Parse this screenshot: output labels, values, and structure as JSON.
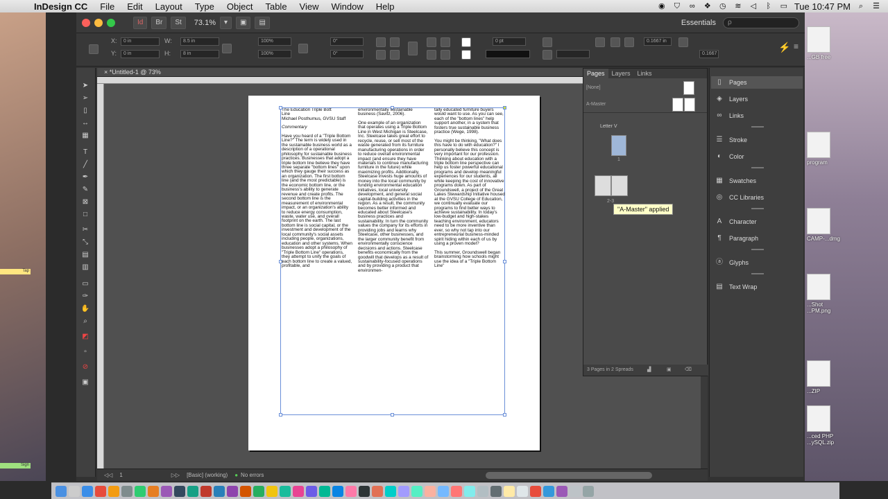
{
  "menubar": {
    "app_name": "InDesign CC",
    "items": [
      "File",
      "Edit",
      "Layout",
      "Type",
      "Object",
      "Table",
      "View",
      "Window",
      "Help"
    ],
    "clock": "Tue 10:47 PM"
  },
  "titlebar": {
    "zoom": "73.1%",
    "workspace": "Essentials",
    "search_placeholder": "ρ"
  },
  "control": {
    "x": "0 in",
    "y": "0 in",
    "w": "8.5 in",
    "h": "8 in",
    "scale_x": "100%",
    "scale_y": "100%",
    "rotate": "0°",
    "shear": "0°",
    "stroke": "0 pt",
    "p1": "0.1667 in",
    "p2": "0.1667"
  },
  "document": {
    "tab": "*Untitled-1 @ 73%",
    "col1": [
      "The Education Triple Bott",
      "Line",
      "Michael Posthumus, GVSU Staff",
      "Commentary",
      "Have you heard of a \"Triple Bottom Line?\" The term is widely used in the sustainable business world as a description of a operational philosophy for sustainable business practices. Businesses that adopt a triple bottom line believe they have three separate \"bottom lines\" upon which they gauge their success as an organization. The first bottom line (and the most predictable) is the economic bottom line, or the business's ability to generate revenue and create profits. The second bottom line is the measurement of environmental impact, or an organization's ability to reduce energy consumption, waste, water use, and overall footprint on the earth. The last bottom line is social capital, or the investment and development of the local community's social assets including people, organizations, education and other systems. When businesses adopt a philosophy of \"Triple Bottom Line\" operations, they attempt to unify the goals of each bottom line to create a valued, profitable, and"
    ],
    "col2": [
      "environmentally sustainable business (Savitz, 2006).",
      "One example of an organization that operates using a Triple Bottom Line in West Michigan is Steelcase, Inc. Steelcase takes great effort to recycle, reuse, or sell most of the waste generated from its furniture manufacturing operations in order to reduce overall environmental impact (and ensure they have materials to continue manufacturing furniture in the future) while maximizing profits. Additionally, Steelcase invests huge amounts of money into the local community by funding environmental education initiatives, local university development, and general social capital-building activities in the region. As a result, the community becomes better informed and educated about Steelcase's business practices and sustainability. In turn the community values the company for its efforts in providing jobs and learns why Steelcase, other businesses, and the larger community benefit from environmentally conscience decisions and actions. Steelcase benefits economically from the goodwill that develops as a result of sustainability-focused operations and by providing a product that environmen-"
    ],
    "col3": [
      "tally educated furniture buyers would want to use. As you can see, each of the \"bottom lines\" help support another, in a system that fosters true sustainable business practice (Wege, 1998).",
      "You might be thinking, \"What does this have to do with education?\" I personally believe this concept is very important for our profession. Thinking about education with a triple bottom line perspective can help us foster powerful educational programs and develop meaningful experiences for our students, all while keeping the cost of innovative programs down. As part of Groundswell, a project of the Great Lakes Stewardship Initiative housed at the GVSU College of Education, we continually evaluate our programs to find better ways to achieve sustainability. In today's low-budget and high-stakes teaching environment, educators need to be more inventive than ever, so why not tap into our entrepreneurial business-minded spirit hiding within each of us by using a proven model?",
      "This summer, Groundswell began brainstorming how schools might use the idea of a \"Triple Bottom Line\""
    ]
  },
  "pages_panel": {
    "tabs": [
      "Pages",
      "Layers",
      "Links"
    ],
    "masters": [
      "[None]",
      "A-Master"
    ],
    "size": "Letter V",
    "page1_label": "1",
    "spread_label": "2-3",
    "tooltip": "\"A-Master\" applied",
    "footer": "3 Pages in 2 Spreads"
  },
  "right_panels": [
    {
      "label": "Pages",
      "icon": "pages-icon"
    },
    {
      "label": "Layers",
      "icon": "layers-icon"
    },
    {
      "label": "Links",
      "icon": "links-icon"
    },
    {
      "label": "Stroke",
      "icon": "stroke-icon"
    },
    {
      "label": "Color",
      "icon": "color-icon"
    },
    {
      "label": "Swatches",
      "icon": "swatches-icon"
    },
    {
      "label": "CC Libraries",
      "icon": "cc-libraries-icon"
    },
    {
      "label": "Character",
      "icon": "character-icon"
    },
    {
      "label": "Paragraph",
      "icon": "paragraph-icon"
    },
    {
      "label": "Glyphs",
      "icon": "glyphs-icon"
    },
    {
      "label": "Text Wrap",
      "icon": "text-wrap-icon"
    }
  ],
  "statusbar": {
    "page": "1",
    "style": "[Basic] (working)",
    "errors": "No errors"
  },
  "desktop": {
    "files": [
      "...GB free",
      "program",
      "CAMP-...dmg",
      "...Shot ...PM.png",
      "...ZIP",
      "...ced PHP ...ySQL.zip"
    ],
    "left_tags": [
      "Tap",
      "Sign"
    ]
  }
}
